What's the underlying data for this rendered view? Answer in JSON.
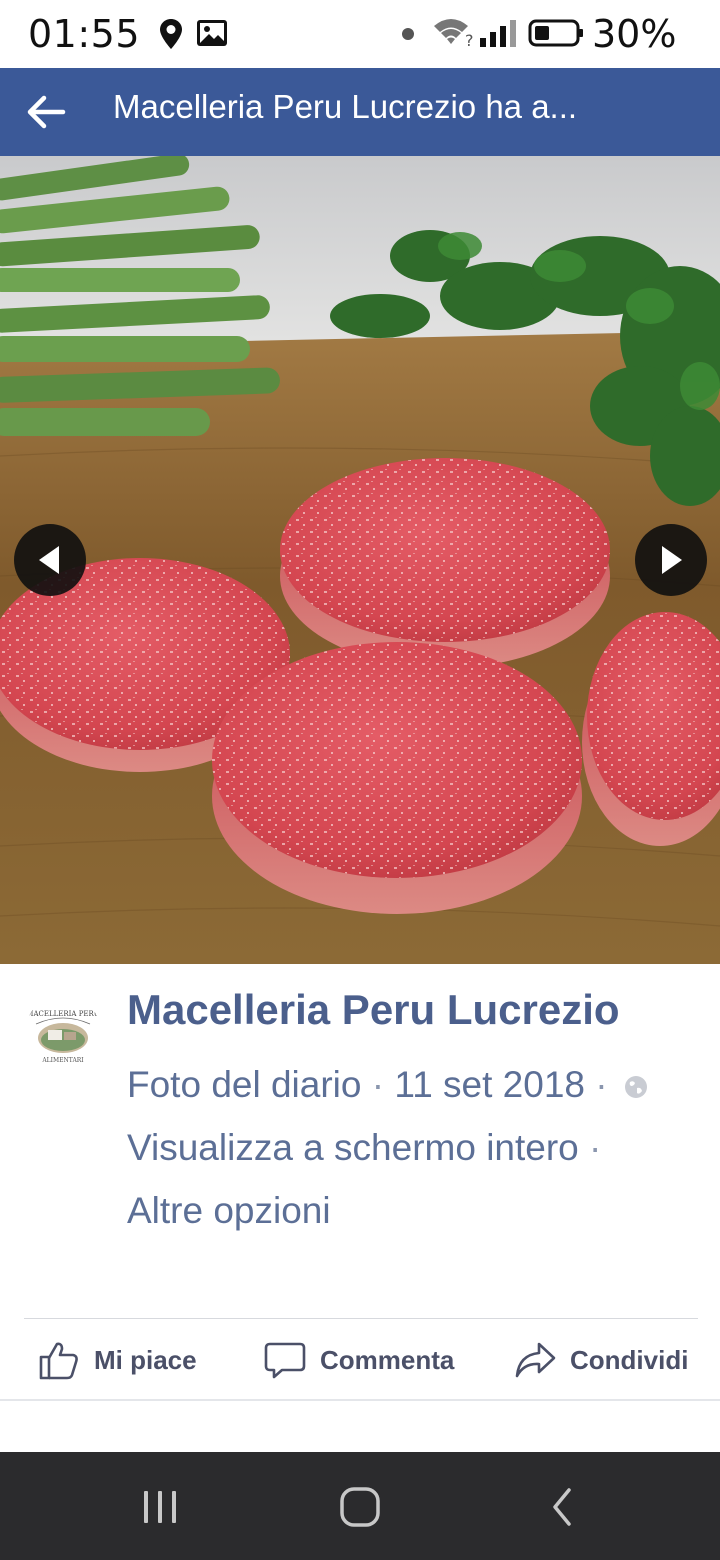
{
  "status_bar": {
    "time": "01:55",
    "battery_percent": "30%",
    "icons": [
      "location-icon",
      "image-icon",
      "notification-dot-icon",
      "wifi-icon",
      "signal-icon",
      "battery-icon"
    ]
  },
  "header": {
    "title": "Macelleria Peru Lucrezio ha a...",
    "back_icon": "arrow-left-icon",
    "background_color": "#3b5998"
  },
  "photo": {
    "prev_icon": "chevron-left-icon",
    "next_icon": "chevron-right-icon"
  },
  "post": {
    "page_name": "Macelleria Peru Lucrezio",
    "album_link": "Foto del diario",
    "separator": "·",
    "date": "11 set 2018",
    "privacy_icon": "globe-icon",
    "fullscreen_link": "Visualizza a schermo intero",
    "more_options_link": "Altre opzioni",
    "avatar_text_top": "MACELLERIA PERU",
    "avatar_text_bottom": "ALIMENTARI"
  },
  "actions": {
    "like_label": "Mi piace",
    "comment_label": "Commenta",
    "share_label": "Condividi"
  },
  "colors": {
    "brand_blue": "#3b5998",
    "name_text": "#4b5f8c",
    "meta_text": "#5c6f96",
    "nav_bar": "#2b2b2d"
  }
}
